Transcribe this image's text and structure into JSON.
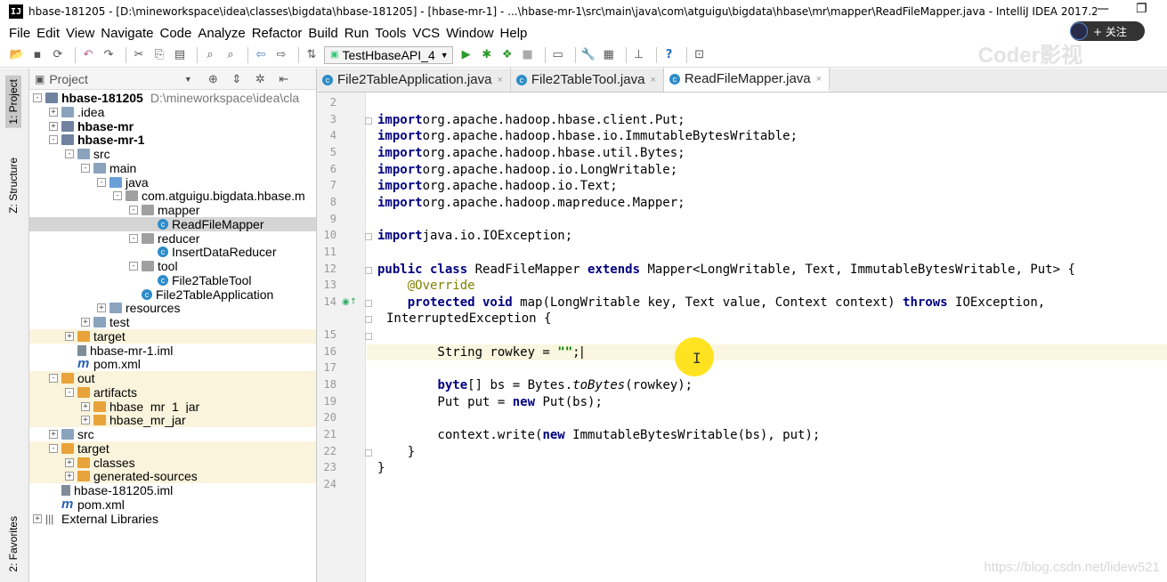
{
  "window": {
    "title": "hbase-181205 - [D:\\mineworkspace\\idea\\classes\\bigdata\\hbase-181205] - [hbase-mr-1] - ...\\hbase-mr-1\\src\\main\\java\\com\\atguigu\\bigdata\\hbase\\mr\\mapper\\ReadFileMapper.java - IntelliJ IDEA 2017.2.5",
    "app_icon": "IJ",
    "follow_label": "+ 关注",
    "watermark_top": "Coder影视",
    "watermark_url": "https://blog.csdn.net/lidew521"
  },
  "menu": [
    "File",
    "Edit",
    "View",
    "Navigate",
    "Code",
    "Analyze",
    "Refactor",
    "Build",
    "Run",
    "Tools",
    "VCS",
    "Window",
    "Help"
  ],
  "toolbar": {
    "run_config": "TestHbaseAPI_4",
    "icons": [
      "open-icon",
      "save-icon",
      "sync-icon",
      "undo-icon",
      "redo-icon",
      "cut-icon",
      "copy-icon",
      "paste-icon",
      "find-icon",
      "replace-icon",
      "back-icon",
      "forward-icon",
      "build-icon",
      "run-icon",
      "debug-icon",
      "coverage-icon",
      "stop-icon",
      "vcs-icon",
      "settings-icon",
      "structure-icon",
      "sdk-icon",
      "help-icon",
      "deploy-icon"
    ]
  },
  "side_tabs": {
    "project": "1: Project",
    "structure": "Z: Structure",
    "favorites": "2: Favorites"
  },
  "project_panel": {
    "header": "Project",
    "tree": [
      {
        "label": "hbase-181205",
        "extra": "D:\\mineworkspace\\idea\\cla",
        "icon": "module",
        "bold": true,
        "exp": "-",
        "indent": 0
      },
      {
        "label": ".idea",
        "icon": "folder",
        "exp": "+",
        "indent": 1
      },
      {
        "label": "hbase-mr",
        "icon": "module",
        "bold": true,
        "exp": "+",
        "indent": 1
      },
      {
        "label": "hbase-mr-1",
        "icon": "module",
        "bold": true,
        "exp": "-",
        "indent": 1
      },
      {
        "label": "src",
        "icon": "folder",
        "exp": "-",
        "indent": 2
      },
      {
        "label": "main",
        "icon": "folder",
        "exp": "-",
        "indent": 3
      },
      {
        "label": "java",
        "icon": "folder-blue",
        "exp": "-",
        "indent": 4
      },
      {
        "label": "com.atguigu.bigdata.hbase.m",
        "icon": "folder-pkg",
        "exp": "-",
        "indent": 5
      },
      {
        "label": "mapper",
        "icon": "folder-pkg",
        "exp": "-",
        "indent": 6
      },
      {
        "label": "ReadFileMapper",
        "icon": "class",
        "exp": "",
        "indent": 7,
        "selected": true
      },
      {
        "label": "reducer",
        "icon": "folder-pkg",
        "exp": "-",
        "indent": 6
      },
      {
        "label": "InsertDataReducer",
        "icon": "class",
        "exp": "",
        "indent": 7
      },
      {
        "label": "tool",
        "icon": "folder-pkg",
        "exp": "-",
        "indent": 6
      },
      {
        "label": "File2TableTool",
        "icon": "class",
        "exp": "",
        "indent": 7
      },
      {
        "label": "File2TableApplication",
        "icon": "class",
        "exp": "",
        "indent": 6
      },
      {
        "label": "resources",
        "icon": "folder",
        "exp": "+",
        "indent": 4
      },
      {
        "label": "test",
        "icon": "folder",
        "exp": "+",
        "indent": 3
      },
      {
        "label": "target",
        "icon": "folder-orange",
        "exp": "+",
        "indent": 2,
        "highlight": true
      },
      {
        "label": "hbase-mr-1.iml",
        "icon": "file",
        "exp": "",
        "indent": 2
      },
      {
        "label": "pom.xml",
        "icon": "maven",
        "exp": "",
        "indent": 2
      },
      {
        "label": "out",
        "icon": "folder-orange",
        "exp": "-",
        "indent": 1,
        "highlight": true
      },
      {
        "label": "artifacts",
        "icon": "folder-orange",
        "exp": "-",
        "indent": 2,
        "highlight": true
      },
      {
        "label": "hbase_mr_1_jar",
        "icon": "folder-orange",
        "exp": "+",
        "indent": 3,
        "highlight": true
      },
      {
        "label": "hbase_mr_jar",
        "icon": "folder-orange",
        "exp": "+",
        "indent": 3,
        "highlight": true
      },
      {
        "label": "src",
        "icon": "folder",
        "exp": "+",
        "indent": 1
      },
      {
        "label": "target",
        "icon": "folder-orange",
        "exp": "-",
        "indent": 1,
        "highlight": true
      },
      {
        "label": "classes",
        "icon": "folder-orange",
        "exp": "+",
        "indent": 2,
        "highlight": true
      },
      {
        "label": "generated-sources",
        "icon": "folder-orange",
        "exp": "+",
        "indent": 2,
        "highlight": true
      },
      {
        "label": "hbase-181205.iml",
        "icon": "file",
        "exp": "",
        "indent": 1
      },
      {
        "label": "pom.xml",
        "icon": "maven",
        "exp": "",
        "indent": 1
      },
      {
        "label": "External Libraries",
        "icon": "lib",
        "exp": "+",
        "indent": 0
      }
    ]
  },
  "tabs": [
    {
      "label": "File2TableApplication.java",
      "active": false
    },
    {
      "label": "File2TableTool.java",
      "active": false
    },
    {
      "label": "ReadFileMapper.java",
      "active": true
    }
  ],
  "editor": {
    "current_line": 16,
    "lines": [
      {
        "n": "2",
        "tokens": []
      },
      {
        "n": "3",
        "tokens": [
          [
            "kw",
            "import"
          ],
          [
            "",
            "org.apache.hadoop.hbase.client.Put;"
          ]
        ]
      },
      {
        "n": "4",
        "tokens": [
          [
            "kw",
            "import"
          ],
          [
            "",
            "org.apache.hadoop.hbase.io.ImmutableBytesWritable;"
          ]
        ]
      },
      {
        "n": "5",
        "tokens": [
          [
            "kw",
            "import"
          ],
          [
            "",
            "org.apache.hadoop.hbase.util.Bytes;"
          ]
        ]
      },
      {
        "n": "6",
        "tokens": [
          [
            "kw",
            "import"
          ],
          [
            "",
            "org.apache.hadoop.io.LongWritable;"
          ]
        ]
      },
      {
        "n": "7",
        "tokens": [
          [
            "kw",
            "import"
          ],
          [
            "",
            "org.apache.hadoop.io.Text;"
          ]
        ]
      },
      {
        "n": "8",
        "tokens": [
          [
            "kw",
            "import"
          ],
          [
            "",
            "org.apache.hadoop.mapreduce.Mapper;"
          ]
        ]
      },
      {
        "n": "9",
        "tokens": []
      },
      {
        "n": "10",
        "tokens": [
          [
            "kw",
            "import"
          ],
          [
            "",
            "java.io.IOException;"
          ]
        ]
      },
      {
        "n": "11",
        "tokens": []
      },
      {
        "n": "12",
        "tokens": [
          [
            "kw",
            "public class"
          ],
          [
            "",
            " ReadFileMapper "
          ],
          [
            "kw",
            "extends"
          ],
          [
            "",
            " Mapper<LongWritable, Text, ImmutableBytesWritable, Put> {"
          ]
        ]
      },
      {
        "n": "13",
        "tokens": [
          [
            "",
            "    "
          ],
          [
            "ann",
            "@Override"
          ]
        ]
      },
      {
        "n": "14",
        "tokens": [
          [
            "",
            "    "
          ],
          [
            "kw",
            "protected void"
          ],
          [
            "",
            " map(LongWritable key, Text value, Context context) "
          ],
          [
            "kw",
            "throws"
          ],
          [
            "",
            " IOException,"
          ]
        ]
      },
      {
        "n": "",
        "tokens": [
          [
            "",
            "InterruptedException {"
          ]
        ]
      },
      {
        "n": "15",
        "tokens": []
      },
      {
        "n": "16",
        "tokens": [
          [
            "",
            "        String rowkey = "
          ],
          [
            "str",
            "\"\""
          ],
          [
            "",
            ";"
          ]
        ]
      },
      {
        "n": "17",
        "tokens": []
      },
      {
        "n": "18",
        "tokens": [
          [
            "",
            "        "
          ],
          [
            "kw",
            "byte"
          ],
          [
            "",
            "[] bs = Bytes."
          ],
          [
            "it",
            "toBytes"
          ],
          [
            "",
            "(rowkey);"
          ]
        ]
      },
      {
        "n": "19",
        "tokens": [
          [
            "",
            "        Put put = "
          ],
          [
            "kw",
            "new"
          ],
          [
            "",
            " Put(bs);"
          ]
        ]
      },
      {
        "n": "20",
        "tokens": []
      },
      {
        "n": "21",
        "tokens": [
          [
            "",
            "        context.write("
          ],
          [
            "kw",
            "new"
          ],
          [
            "",
            " ImmutableBytesWritable(bs), put);"
          ]
        ]
      },
      {
        "n": "22",
        "tokens": [
          [
            "",
            "    }"
          ]
        ]
      },
      {
        "n": "23",
        "tokens": [
          [
            "",
            "}"
          ]
        ]
      },
      {
        "n": "24",
        "tokens": []
      }
    ]
  }
}
